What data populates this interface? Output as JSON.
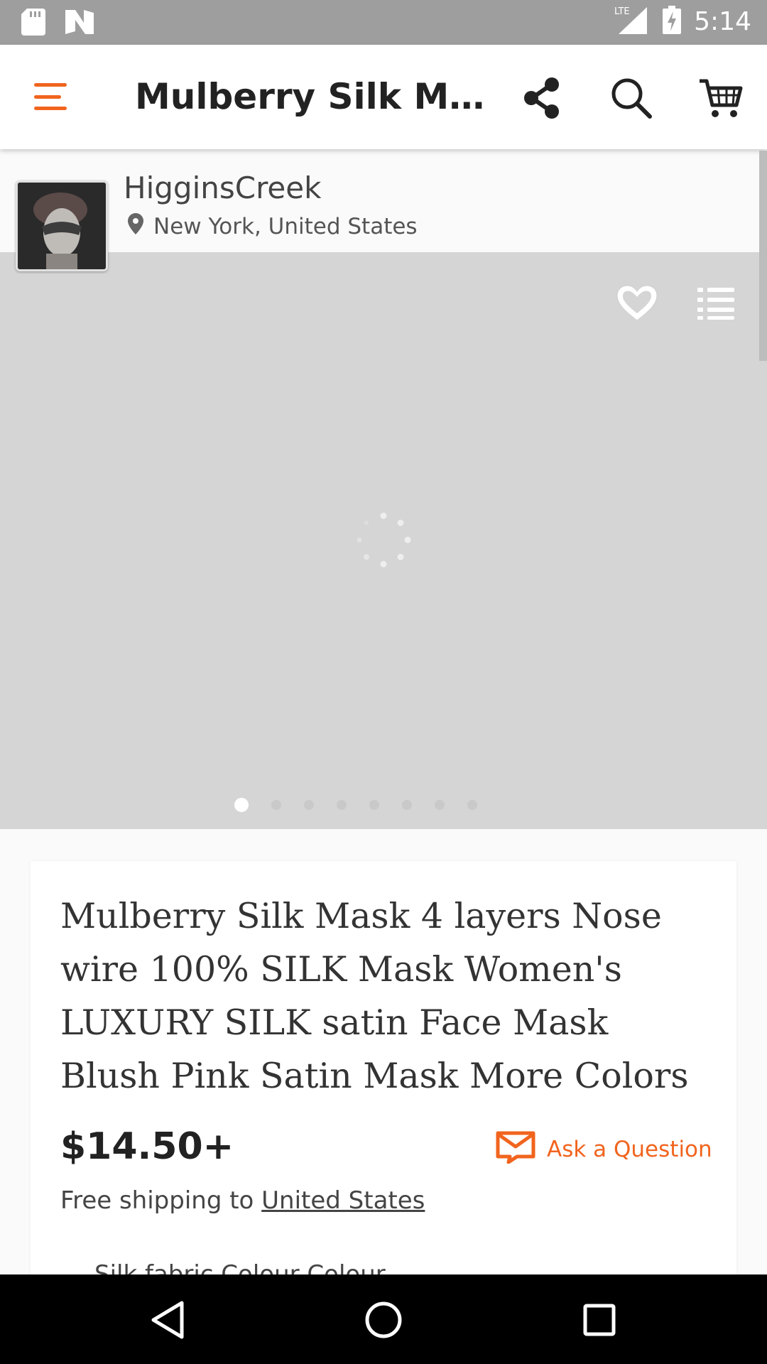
{
  "status_bar": {
    "time": "5:14",
    "network": "LTE",
    "icons": [
      "sd-card-icon",
      "n-logo-icon",
      "lte-signal-icon",
      "battery-charging-icon"
    ]
  },
  "app_bar": {
    "title": "Mulberry Silk Mas…",
    "icons": [
      "menu-icon",
      "share-icon",
      "search-icon",
      "cart-icon"
    ],
    "accent_color": "#f1641e"
  },
  "shop": {
    "name": "HigginsCreek",
    "location": "New York, United States"
  },
  "gallery": {
    "image_count": 8,
    "active_index": 0,
    "background_color": "#d5d5d5"
  },
  "listing": {
    "title": "Mulberry Silk Mask 4 layers Nose wire 100% SILK Mask Women's LUXURY SILK satin Face Mask Blush Pink Satin Mask More Colors",
    "price": "$14.50+",
    "ask_label": "Ask a Question",
    "shipping_prefix": "Free shipping to ",
    "shipping_destination": "United States",
    "next_section_partial": "Silk fabric Colour    Colour"
  },
  "nav_bar": {
    "icons": [
      "back-icon",
      "home-icon",
      "recents-icon"
    ]
  }
}
